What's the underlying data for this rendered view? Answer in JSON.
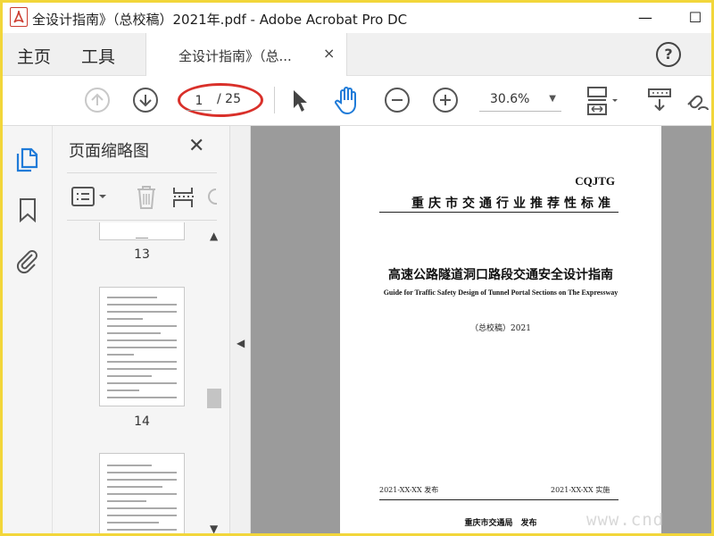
{
  "window": {
    "title": "全设计指南》（总校稿）2021年.pdf - Adobe Acrobat Pro DC",
    "app_icon_label": "",
    "minimize": "—",
    "maximize": "☐"
  },
  "tabs": {
    "home": "主页",
    "tools": "工具",
    "document": "全设计指南》（总...",
    "close": "×",
    "help": "?"
  },
  "toolbar": {
    "current_page": "1",
    "total_pages": "/ 25",
    "zoom": "30.6%"
  },
  "thumbnails": {
    "title": "页面缩略图",
    "close": "✕",
    "pages": [
      {
        "label": "13"
      },
      {
        "label": "14"
      }
    ]
  },
  "page": {
    "code": "CQJTG",
    "standard": "重庆市交通行业推荐性标准",
    "title": "高速公路隧道洞口路段交通安全设计指南",
    "subtitle": "Guide for Traffic Safety Design of Tunnel Portal Sections on The Expressway",
    "draft": "（总校稿）2021",
    "publish": "2021-XX-XX 发布",
    "implement": "2021-XX-XX 实施",
    "issuer": "重庆市交通局　发布"
  },
  "watermark": "www.cnd",
  "colors": {
    "frame": "#f2d63a",
    "highlight_oval": "#d9302a",
    "hand_tool": "#1f7bd8",
    "active_rail_icon": "#1f7bd8"
  }
}
